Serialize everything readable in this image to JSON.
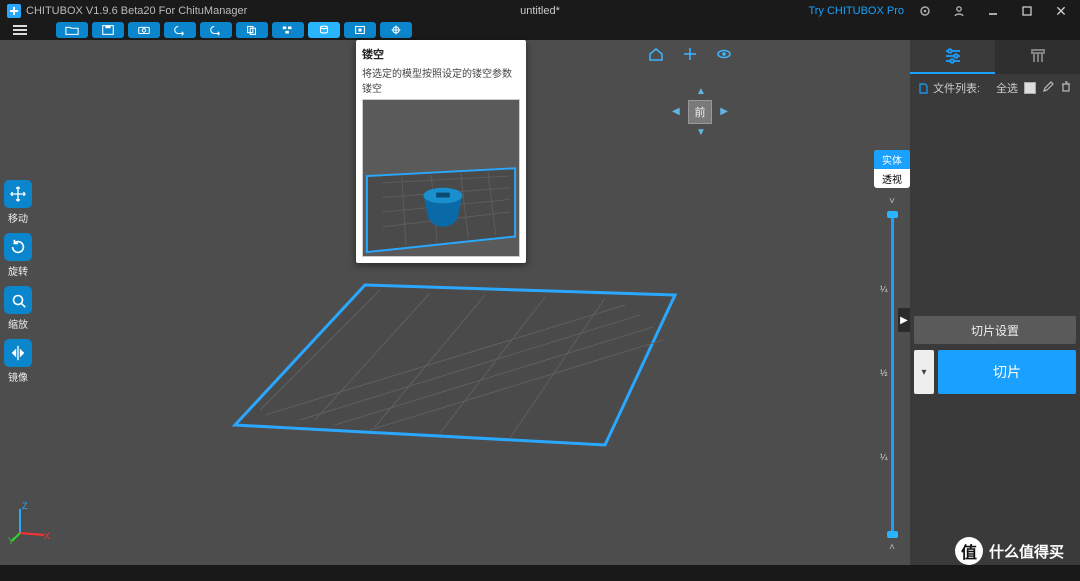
{
  "titlebar": {
    "app_name": "CHITUBOX V1.9.6 Beta20 For ChituManager",
    "document": "untitled*",
    "try_pro": "Try CHITUBOX Pro"
  },
  "left_tools": {
    "move": "移动",
    "rotate": "旋转",
    "scale": "缩放",
    "mirror": "镜像"
  },
  "tooltip": {
    "title": "镂空",
    "description": "将选定的模型按照设定的镂空参数镂空"
  },
  "viewcube": {
    "front": "前"
  },
  "shading": {
    "solid": "实体",
    "perspective": "透视"
  },
  "slider": {
    "tick_top": "¼",
    "tick_mid": "½",
    "tick_bot": "¼"
  },
  "sidepanel": {
    "file_list_label": "文件列表:",
    "select_all": "全选",
    "slice_settings": "切片设置",
    "slice_button": "切片",
    "dropdown_glyph": "▾"
  },
  "axis": {
    "x": "X",
    "y": "Y",
    "z": "Z"
  },
  "gizmos": {
    "home": "⌂",
    "move": "✥",
    "eye": "👁"
  },
  "watermark": {
    "text": "什么值得买",
    "badge": "值"
  }
}
